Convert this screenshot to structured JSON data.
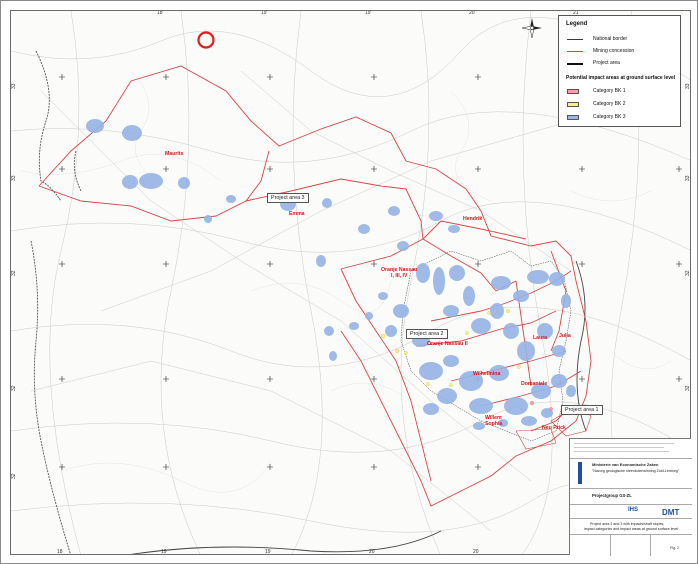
{
  "legend": {
    "title": "Legend",
    "items": [
      {
        "label": "National border",
        "color": "#3a3a3a"
      },
      {
        "label": "Mining concession",
        "color": "#e04040"
      },
      {
        "label": "Project area",
        "color": "#111111"
      }
    ],
    "impact_title": "Potential impact areas at ground surface level",
    "categories": [
      {
        "label": "Category BK 1",
        "color": "#f4a3a3"
      },
      {
        "label": "Category BK 2",
        "color": "#f7f08a"
      },
      {
        "label": "Category BK 3",
        "color": "#9bb6e6"
      }
    ]
  },
  "map": {
    "highlight_color": "#e31b1b",
    "concession_color": "#e04848",
    "impact_color": "#96b3e4",
    "labels": {
      "maurits": "Maurits",
      "emma": "Emma",
      "hendrik": "Hendrik",
      "oranje_nassau_1": "Oranje Nassau",
      "oranje_nassau_1b": "I, III, IV",
      "oranje_nassau_2": "Oranje Nassau II",
      "laura": "Laura",
      "julia": "Julia",
      "wilhelmina": "Wilhelmina",
      "domaniale": "Domaniale",
      "willem_sophia_1": "Willem",
      "willem_sophia_2": "Sophia",
      "neu_prick": "Neu Prick"
    },
    "project_areas": {
      "pa1": "Project area 1",
      "pa2": "Project area 2",
      "pa3": "Project area 3"
    },
    "grid_labels": {
      "top": [
        "18",
        "19",
        "19",
        "20",
        "21"
      ],
      "bottom": [
        "18",
        "19",
        "19",
        "20",
        "20"
      ],
      "left": [
        "33",
        "33",
        "32",
        "32",
        "32"
      ],
      "right": [
        "33",
        "33",
        "32",
        "32",
        "32"
      ]
    }
  },
  "title_block": {
    "ministry": "Ministerie van Economische Zaken",
    "project": "\"Nazorg geologische steenkolenwinning Zuid-Limburg\"",
    "group": "Projectgroup GS-ZL",
    "company": "DMT",
    "ihs": "IHS",
    "drawing_title_1": "Project area 2 and 3 with impacts/shaft slopes,",
    "drawing_title_2": "impact categories and impact areas at ground surface level",
    "sheet": "Fig. 2"
  }
}
